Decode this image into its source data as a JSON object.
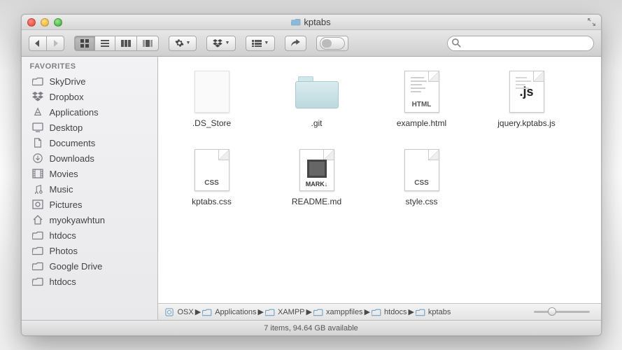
{
  "window": {
    "title": "kptabs"
  },
  "toolbar": {
    "search_placeholder": ""
  },
  "sidebar": {
    "header": "FAVORITES",
    "items": [
      {
        "label": "SkyDrive",
        "icon": "folder-icon"
      },
      {
        "label": "Dropbox",
        "icon": "dropbox-icon"
      },
      {
        "label": "Applications",
        "icon": "applications-icon"
      },
      {
        "label": "Desktop",
        "icon": "desktop-icon"
      },
      {
        "label": "Documents",
        "icon": "documents-icon"
      },
      {
        "label": "Downloads",
        "icon": "downloads-icon"
      },
      {
        "label": "Movies",
        "icon": "movies-icon"
      },
      {
        "label": "Music",
        "icon": "music-icon"
      },
      {
        "label": "Pictures",
        "icon": "pictures-icon"
      },
      {
        "label": "myokyawhtun",
        "icon": "home-icon"
      },
      {
        "label": "htdocs",
        "icon": "folder-icon"
      },
      {
        "label": "Photos",
        "icon": "folder-icon"
      },
      {
        "label": "Google Drive",
        "icon": "folder-icon"
      },
      {
        "label": "htdocs",
        "icon": "folder-icon"
      }
    ]
  },
  "files": [
    {
      "name": ".DS_Store",
      "kind": "blank"
    },
    {
      "name": ".git",
      "kind": "folder"
    },
    {
      "name": "example.html",
      "kind": "html",
      "badge": "HTML"
    },
    {
      "name": "jquery.kptabs.js",
      "kind": "js",
      "badge": ".js"
    },
    {
      "name": "kptabs.css",
      "kind": "css",
      "badge": "CSS"
    },
    {
      "name": "README.md",
      "kind": "md",
      "badge": "MARK↓"
    },
    {
      "name": "style.css",
      "kind": "css",
      "badge": "CSS"
    }
  ],
  "path": [
    {
      "label": "OSX",
      "icon": "disk-icon"
    },
    {
      "label": "Applications",
      "icon": "folder-icon"
    },
    {
      "label": "XAMPP",
      "icon": "folder-icon"
    },
    {
      "label": "xamppfiles",
      "icon": "folder-icon"
    },
    {
      "label": "htdocs",
      "icon": "folder-icon"
    },
    {
      "label": "kptabs",
      "icon": "folder-icon"
    }
  ],
  "status": "7 items, 94.64 GB available"
}
